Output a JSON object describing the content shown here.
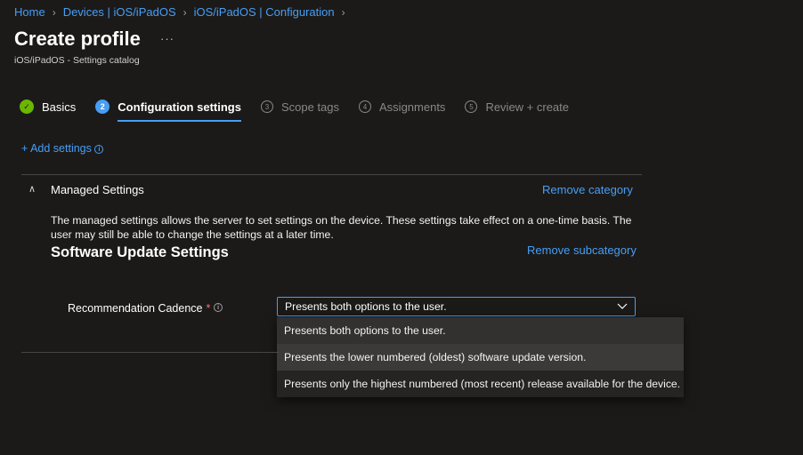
{
  "breadcrumb": [
    {
      "label": "Home"
    },
    {
      "label": "Devices | iOS/iPadOS"
    },
    {
      "label": "iOS/iPadOS | Configuration"
    }
  ],
  "page": {
    "title": "Create profile",
    "more": "···",
    "subtitle": "iOS/iPadOS - Settings catalog"
  },
  "wizard": {
    "steps": [
      {
        "label": "Basics",
        "marker": "✓",
        "state": "done"
      },
      {
        "label": "Configuration settings",
        "marker": "2",
        "state": "current"
      },
      {
        "label": "Scope tags",
        "marker": "3",
        "state": "todo"
      },
      {
        "label": "Assignments",
        "marker": "4",
        "state": "todo"
      },
      {
        "label": "Review + create",
        "marker": "5",
        "state": "todo"
      }
    ]
  },
  "actions": {
    "add_settings": "+ Add settings"
  },
  "category": {
    "title": "Managed Settings",
    "remove_label": "Remove category",
    "description": "The managed settings allows the server to set settings on the device. These settings take effect on a one-time basis. The user may still be able to change the settings at a later time.",
    "subcategory": {
      "title": "Software Update Settings",
      "remove_label": "Remove subcategory",
      "setting": {
        "label": "Recommendation Cadence",
        "required_marker": "*",
        "selected_value": "Presents both options to the user.",
        "options": [
          "Presents both options to the user.",
          "Presents the lower numbered (oldest) software update version.",
          "Presents only the highest numbered (most recent) release available for the device."
        ]
      }
    }
  },
  "icons": {
    "info": "i",
    "chevron_up": "∧"
  },
  "colors": {
    "background": "#1b1a19",
    "link": "#479ef5",
    "success": "#6bb700",
    "required": "#f1707b"
  }
}
